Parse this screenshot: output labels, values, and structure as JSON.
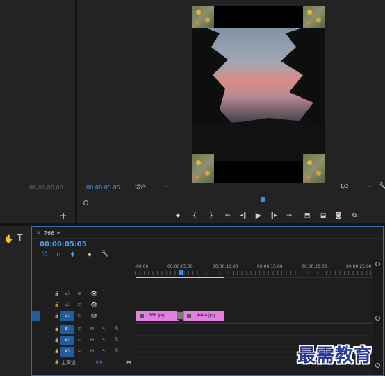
{
  "source_monitor": {
    "timecode": "00;00;00;00",
    "add_label": "+"
  },
  "program_monitor": {
    "timecode": "00:00:05:05",
    "fit_value": "适合",
    "resolution": "1/2"
  },
  "tools": {
    "hand": "✋",
    "type": "T"
  },
  "sequence": {
    "close": "×",
    "name": "766",
    "menu": "≡",
    "timecode": "00:00:05:05",
    "ruler": [
      ":00:00",
      "00:00:05:00",
      "00:00:10:00",
      "00:00:15:00",
      "00:00:20:00",
      "00:00:25:00"
    ],
    "tracks": {
      "v3": "V3",
      "v2": "V2",
      "v1": "V1",
      "a1": "A1",
      "a2": "A2",
      "a3": "A3",
      "mute": "M",
      "solo": "S",
      "master": "主声道",
      "master_value": "0.0"
    },
    "clips": [
      {
        "name": "766.jpg"
      },
      {
        "name": "4444.jpg"
      }
    ]
  },
  "watermark": "最需教育",
  "colors": {
    "accent": "#4a9df8",
    "clip": "#e37fe0",
    "playhead": "#3a8df0",
    "workarea": "#e8d83a"
  }
}
